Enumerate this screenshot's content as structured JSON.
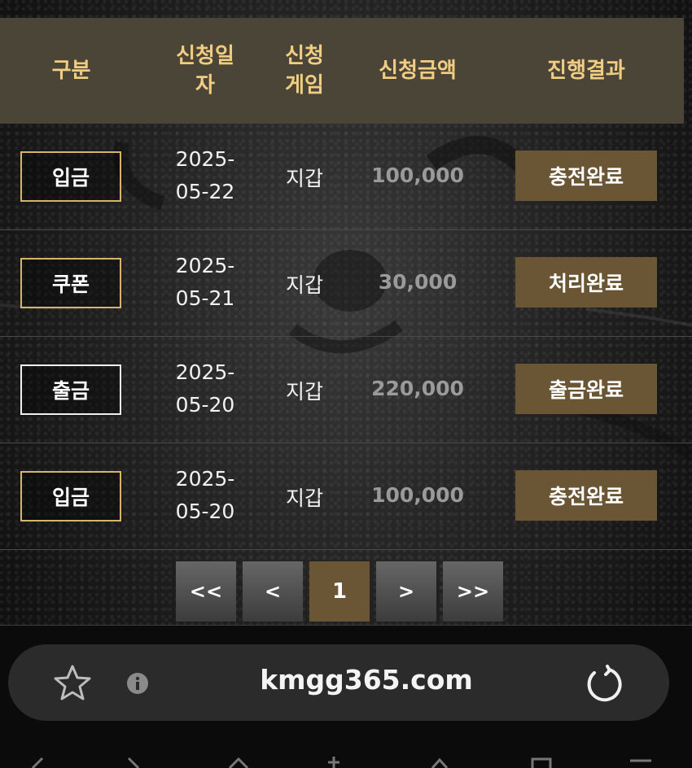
{
  "table": {
    "headers": {
      "type": "구분",
      "date_line1": "신청일",
      "date_line2": "자",
      "game_line1": "신청",
      "game_line2": "게임",
      "amount": "신청금액",
      "status": "진행결과"
    },
    "rows": [
      {
        "type": "입금",
        "date_line1": "2025-",
        "date_line2": "05-22",
        "game": "지갑",
        "amount": "100,000",
        "status": "충전완료"
      },
      {
        "type": "쿠폰",
        "date_line1": "2025-",
        "date_line2": "05-21",
        "game": "지갑",
        "amount": "30,000",
        "status": "처리완료"
      },
      {
        "type": "출금",
        "date_line1": "2025-",
        "date_line2": "05-20",
        "game": "지갑",
        "amount": "220,000",
        "status": "출금완료"
      },
      {
        "type": "입금",
        "date_line1": "2025-",
        "date_line2": "05-20",
        "game": "지갑",
        "amount": "100,000",
        "status": "충전완료"
      }
    ]
  },
  "pagination": {
    "first": "<<",
    "prev": "<",
    "current": "1",
    "next": ">",
    "last": ">>"
  },
  "browser": {
    "url": "kmgg365.com",
    "icons": [
      "star-icon",
      "info-icon",
      "reload-icon"
    ]
  },
  "colors": {
    "header_bg": "#4b4538",
    "header_text": "#f0cd82",
    "status_bg": "#6a5535",
    "badge_border": "#d8b46a",
    "amount_text": "#9a9a9a"
  }
}
